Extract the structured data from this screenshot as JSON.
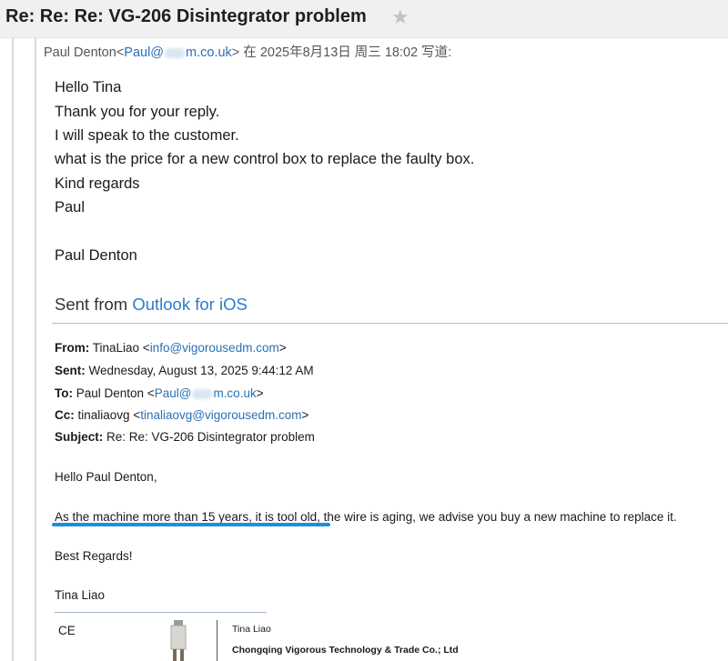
{
  "subject": "Re: Re: Re: VG-206 Disintegrator problem",
  "star_icon": "star-icon",
  "quote_header": {
    "sender_name": "Paul Denton",
    "email_prefix": "Paul@",
    "email_suffix": "m.co.uk",
    "suffix": " 在 2025年8月13日 周三 18:02 写道:"
  },
  "body_lines": [
    "Hello Tina",
    "Thank you for your reply.",
    "I will speak to the customer.",
    "what is the price for a new control box to replace the faulty box.",
    "Kind regards",
    "Paul",
    "Paul Denton"
  ],
  "sent_from": {
    "prefix": "Sent from ",
    "link": "Outlook for iOS"
  },
  "forwarded": {
    "from_label": "From:",
    "from_name": " TinaLiao <",
    "from_email": "info@vigorousedm.com",
    "from_close": ">",
    "sent_label": "Sent:",
    "sent_value": " Wednesday, August 13, 2025 9:44:12 AM",
    "to_label": "To:",
    "to_name": " Paul Denton <",
    "to_email_prefix": "Paul@",
    "to_email_suffix": "m.co.uk",
    "to_close": ">",
    "cc_label": "Cc:",
    "cc_name": " tinaliaovg <",
    "cc_email": "tinaliaovg@vigorousedm.com",
    "cc_close": ">",
    "subject_label": "Subject:",
    "subject_value": " Re: Re: VG-206 Disintegrator problem"
  },
  "reply": {
    "greeting": "Hello Paul Denton,",
    "message": "As the machine more than 15 years, it is tool old, the wire is aging, we advise you buy a new machine to replace it.",
    "closing": "Best Regards!",
    "signature_name": "Tina Liao"
  },
  "signature": {
    "ce": "CE",
    "name": "Tina Liao",
    "company": "Chongqing Vigorous Technology & Trade Co.; Ltd"
  },
  "colors": {
    "link": "#2b6fb6",
    "highlight_underline": "#1a90e0"
  }
}
